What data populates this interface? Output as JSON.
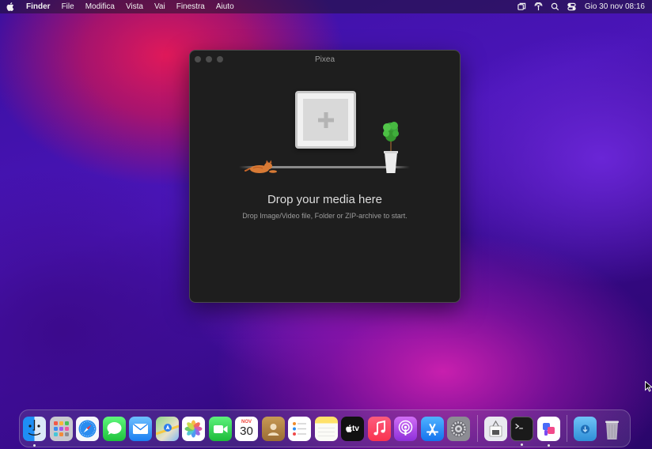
{
  "menubar": {
    "app_name": "Finder",
    "items": [
      "File",
      "Modifica",
      "Vista",
      "Vai",
      "Finestra",
      "Aiuto"
    ],
    "status_icons": [
      "stage-manager-icon",
      "airdrop-icon",
      "spotlight-search-icon",
      "control-center-icon"
    ],
    "clock": "Gio 30 nov  08:16"
  },
  "window": {
    "title": "Pixea",
    "drop_heading": "Drop your media here",
    "drop_subtitle": "Drop Image/Video file, Folder or ZIP-archive to start."
  },
  "dock": {
    "apps": [
      {
        "name": "Finder",
        "icon": "finder-icon",
        "running": true
      },
      {
        "name": "Launchpad",
        "icon": "launchpad-icon",
        "running": false
      },
      {
        "name": "Safari",
        "icon": "safari-icon",
        "running": false
      },
      {
        "name": "Messages",
        "icon": "messages-icon",
        "running": false
      },
      {
        "name": "Mail",
        "icon": "mail-icon",
        "running": false
      },
      {
        "name": "Maps",
        "icon": "maps-icon",
        "running": false
      },
      {
        "name": "Photos",
        "icon": "photos-icon",
        "running": false
      },
      {
        "name": "FaceTime",
        "icon": "facetime-icon",
        "running": false
      },
      {
        "name": "Calendar",
        "icon": "calendar-icon",
        "running": false,
        "month": "NOV",
        "day": "30"
      },
      {
        "name": "Contacts",
        "icon": "contacts-icon",
        "running": false
      },
      {
        "name": "Reminders",
        "icon": "reminders-icon",
        "running": false
      },
      {
        "name": "Notes",
        "icon": "notes-icon",
        "running": false
      },
      {
        "name": "TV",
        "icon": "tv-icon",
        "running": false,
        "label": "tv"
      },
      {
        "name": "Music",
        "icon": "music-icon",
        "running": false
      },
      {
        "name": "Podcasts",
        "icon": "podcasts-icon",
        "running": false
      },
      {
        "name": "App Store",
        "icon": "app-store-icon",
        "running": false
      },
      {
        "name": "System Settings",
        "icon": "settings-icon",
        "running": false
      },
      {
        "name": "Preview",
        "icon": "preview-icon",
        "running": false
      },
      {
        "name": "Terminal",
        "icon": "terminal-icon",
        "running": true
      },
      {
        "name": "Pixea",
        "icon": "pixea-icon",
        "running": true
      },
      {
        "name": "Downloads",
        "icon": "downloads-folder-icon",
        "running": false
      },
      {
        "name": "Trash",
        "icon": "trash-icon",
        "running": false
      }
    ]
  },
  "colors": {
    "window_bg": "#1e1e1e",
    "menubar_text": "#f2f2f2",
    "wallpaper_primary": "#3a0fa0",
    "wallpaper_accent": "#e0195a"
  }
}
